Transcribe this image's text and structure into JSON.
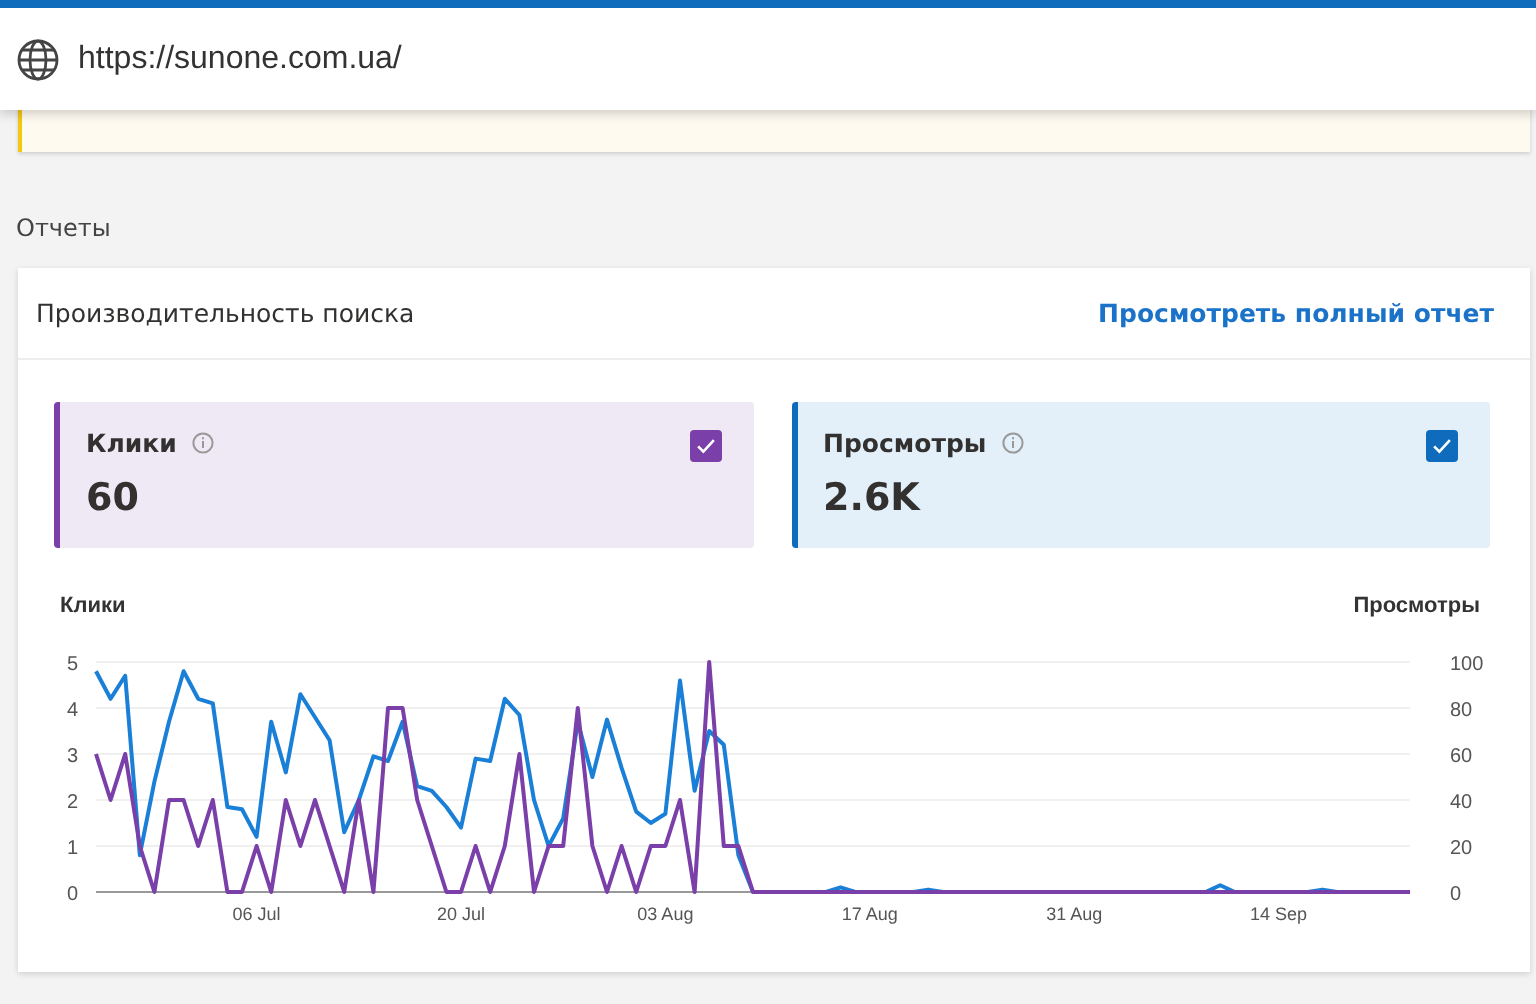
{
  "address_bar": {
    "url": "https://sunone.com.ua/"
  },
  "section_title": "Отчеты",
  "card": {
    "title": "Производительность поиска",
    "link": "Просмотреть полный отчет",
    "metrics": [
      {
        "kind": "clicks",
        "label": "Клики",
        "value": "60",
        "checked": true,
        "color": "#7a3fa8"
      },
      {
        "kind": "impressions",
        "label": "Просмотры",
        "value": "2.6K",
        "checked": true,
        "color": "#0f6cbd"
      }
    ],
    "chart_data": {
      "type": "line",
      "grid": true,
      "ylabel": "Клики",
      "y2label": "Просмотры",
      "ylim": [
        0,
        5
      ],
      "yticks": [
        0,
        1,
        2,
        3,
        4,
        5
      ],
      "y2lim": [
        0,
        100
      ],
      "y2ticks": [
        0,
        20,
        40,
        60,
        80,
        100
      ],
      "categories": [
        null,
        null,
        null,
        null,
        null,
        null,
        null,
        null,
        null,
        null,
        null,
        "06 Jul",
        null,
        null,
        null,
        null,
        null,
        null,
        null,
        null,
        null,
        null,
        null,
        null,
        null,
        "20 Jul",
        null,
        null,
        null,
        null,
        null,
        null,
        null,
        null,
        null,
        null,
        null,
        null,
        null,
        "03 Aug",
        null,
        null,
        null,
        null,
        null,
        null,
        null,
        null,
        null,
        null,
        null,
        null,
        null,
        "17 Aug",
        null,
        null,
        null,
        null,
        null,
        null,
        null,
        null,
        null,
        null,
        null,
        null,
        null,
        "31 Aug",
        null,
        null,
        null,
        null,
        null,
        null,
        null,
        null,
        null,
        null,
        null,
        null,
        null,
        "14 Sep",
        null,
        null,
        null,
        null,
        null,
        null,
        null,
        null,
        null
      ],
      "series": [
        {
          "color": "#1a7fd6",
          "axis": "y2",
          "values": [
            96,
            84,
            94,
            16,
            48,
            74,
            96,
            84,
            82,
            37,
            36,
            24,
            74,
            52,
            86,
            76,
            66,
            26,
            40,
            59,
            57,
            74,
            46,
            44,
            37,
            28,
            58,
            57,
            84,
            77,
            40,
            20,
            32,
            74,
            50,
            75,
            54,
            35,
            30,
            34,
            92,
            44,
            70,
            64,
            16,
            0,
            0,
            0,
            0,
            0,
            0,
            2,
            0,
            0,
            0,
            0,
            0,
            1,
            0,
            0,
            0,
            0,
            0,
            0,
            0,
            0,
            0,
            0,
            0,
            0,
            0,
            0,
            0,
            0,
            0,
            0,
            0,
            3,
            0,
            0,
            0,
            0,
            0,
            0,
            1,
            0,
            0,
            null,
            null,
            null,
            null
          ]
        },
        {
          "color": "#7a3fa8",
          "values": [
            3,
            2,
            3,
            1,
            0,
            2,
            2,
            1,
            2,
            0,
            0,
            1,
            0,
            2,
            1,
            2,
            1,
            0,
            2,
            0,
            4,
            4,
            2,
            1,
            0,
            0,
            1,
            0,
            1,
            3,
            0,
            1,
            1,
            4,
            1,
            0,
            1,
            0,
            1,
            1,
            2,
            0,
            5,
            1,
            1,
            0,
            0,
            0,
            0,
            0,
            0,
            0,
            0,
            0,
            0,
            0,
            0,
            0,
            0,
            0,
            0,
            0,
            0,
            0,
            0,
            0,
            0,
            0,
            0,
            0,
            0,
            0,
            0,
            0,
            0,
            0,
            0,
            0,
            0,
            0,
            0,
            0,
            0,
            0,
            0,
            0,
            0,
            0,
            0,
            0,
            0
          ]
        }
      ]
    }
  }
}
